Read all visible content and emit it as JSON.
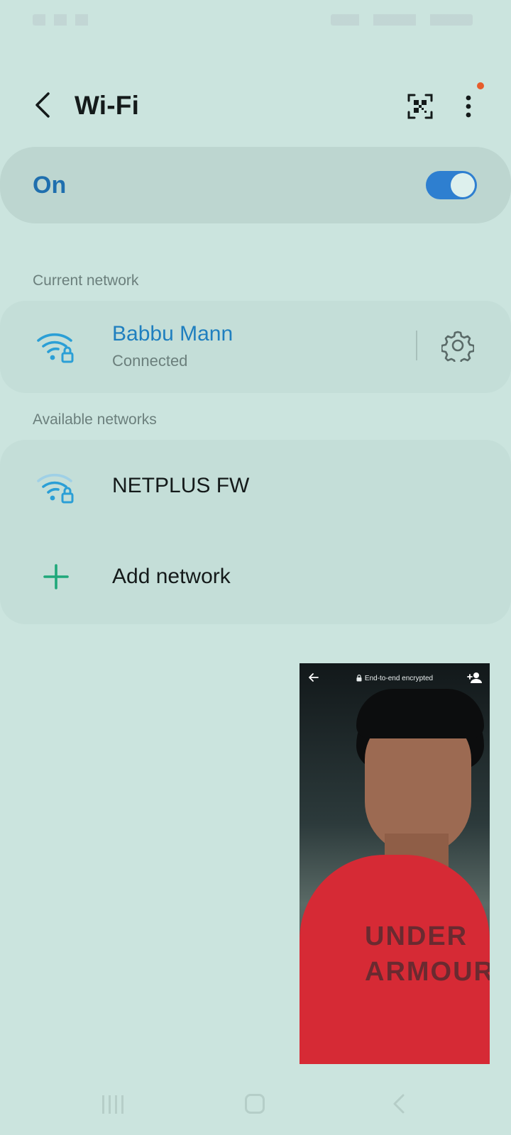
{
  "header": {
    "title": "Wi-Fi",
    "back_icon": "back-arrow-icon",
    "qr_icon": "qr-code-icon",
    "more_icon": "more-vertical-icon",
    "notification_dot_color": "#e65c2b"
  },
  "wifi_toggle": {
    "label": "On",
    "state": true,
    "accent_color": "#2e7fd0"
  },
  "current_network": {
    "section_label": "Current network",
    "name": "Babbu Mann",
    "status": "Connected",
    "icon": "wifi-locked-icon",
    "settings_icon": "gear-icon",
    "name_color": "#1f7fbf"
  },
  "available_networks": {
    "section_label": "Available networks",
    "items": [
      {
        "name": "NETPLUS FW",
        "icon": "wifi-locked-icon"
      }
    ],
    "add": {
      "label": "Add network",
      "icon": "plus-icon",
      "icon_color": "#1fa87a"
    }
  },
  "pip_video": {
    "encryption_label": "End-to-end encrypted",
    "shirt_text": "UNDER ARMOUR",
    "back_icon": "back-arrow-icon",
    "lock_icon": "lock-icon",
    "add_person_icon": "add-person-icon"
  },
  "navigation_bar": {
    "recent_icon": "recent-apps-icon",
    "home_icon": "home-icon",
    "back_icon": "back-icon"
  }
}
